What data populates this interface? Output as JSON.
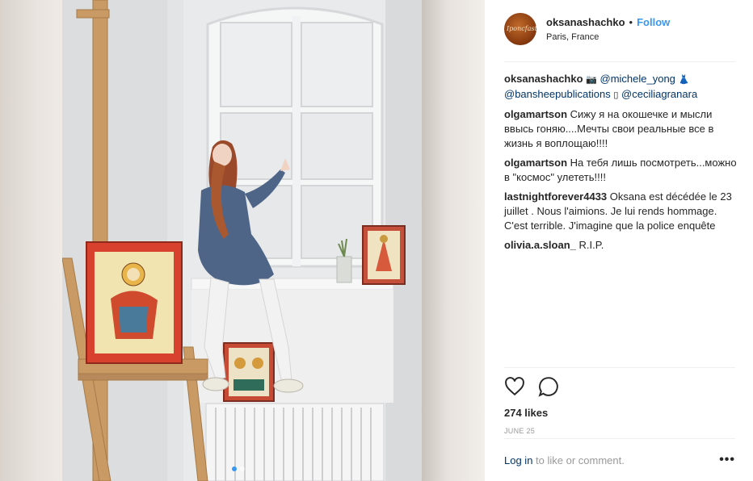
{
  "post": {
    "photo_alt": "Woman sitting on windowsill with painted icons and easel",
    "carousel": {
      "count": 2,
      "active_index": 0
    }
  },
  "header": {
    "username": "oksanashachko",
    "bullet": "•",
    "follow_label": "Follow",
    "location": "Paris, France",
    "avatar_text": "Iponcfast"
  },
  "caption": {
    "username": "oksanashachko",
    "camera_glyph": "📷",
    "tag1": "@michele_yong",
    "dress_glyph": "👗",
    "tag2": "@bansheepublications",
    "box_glyph": "▯",
    "tag3": "@ceciliagranara"
  },
  "comments": [
    {
      "username": "olgamartson",
      "text": "Сижу я на окошечке и мысли ввысь гоняю....Мечты свои реальные все в жизнь я воплощаю!!!!"
    },
    {
      "username": "olgamartson",
      "text": "На тебя лишь посмотреть...можно в \"космос\" улететь!!!!"
    },
    {
      "username": "lastnightforever4433",
      "text": "Oksana est décédée le 23 juillet . Nous l'aimions. Je lui rends hommage. C'est terrible. J'imagine que la police enquête"
    },
    {
      "username": "olivia.a.sloan_",
      "text": "R.I.P."
    }
  ],
  "actions": {
    "like_icon": "heart-icon",
    "comment_icon": "comment-icon"
  },
  "likes": "274 likes",
  "date": "JUNE 25",
  "footer": {
    "login_label": "Log in",
    "login_suffix": " to like or comment.",
    "more_label": "•••"
  },
  "colors": {
    "accent": "#3897f0",
    "link": "#003569",
    "muted": "#999999",
    "text": "#262626"
  }
}
